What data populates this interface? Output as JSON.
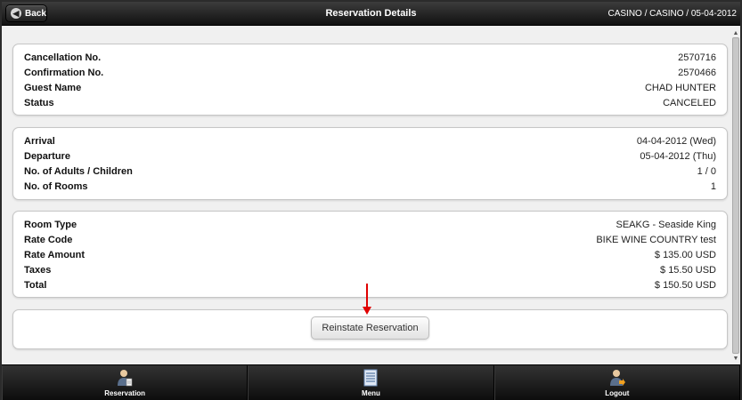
{
  "header": {
    "back_label": "Back",
    "title": "Reservation Details",
    "location": "CASINO / CASINO / 05-04-2012"
  },
  "sections": [
    {
      "rows": [
        {
          "label": "Cancellation No.",
          "value": "2570716"
        },
        {
          "label": "Confirmation No.",
          "value": "2570466"
        },
        {
          "label": "Guest Name",
          "value": "CHAD HUNTER"
        },
        {
          "label": "Status",
          "value": "CANCELED"
        }
      ]
    },
    {
      "rows": [
        {
          "label": "Arrival",
          "value": "04-04-2012 (Wed)"
        },
        {
          "label": "Departure",
          "value": "05-04-2012 (Thu)"
        },
        {
          "label": "No. of Adults / Children",
          "value": "1 / 0"
        },
        {
          "label": "No. of Rooms",
          "value": "1"
        }
      ]
    },
    {
      "rows": [
        {
          "label": "Room Type",
          "value": "SEAKG - Seaside King"
        },
        {
          "label": "Rate Code",
          "value": "BIKE WINE COUNTRY test"
        },
        {
          "label": "Rate Amount",
          "value": "$ 135.00 USD"
        },
        {
          "label": "Taxes",
          "value": "$ 15.50 USD"
        },
        {
          "label": "Total",
          "value": "$ 150.50 USD"
        }
      ]
    }
  ],
  "action": {
    "reinstate_label": "Reinstate Reservation"
  },
  "footer": {
    "items": [
      {
        "label": "Reservation",
        "icon": "reservation-icon"
      },
      {
        "label": "Menu",
        "icon": "menu-icon"
      },
      {
        "label": "Logout",
        "icon": "logout-icon"
      }
    ]
  },
  "colors": {
    "header_bg": "#1a1a1a",
    "arrow": "#e00000",
    "footer_bg": "#151515"
  }
}
